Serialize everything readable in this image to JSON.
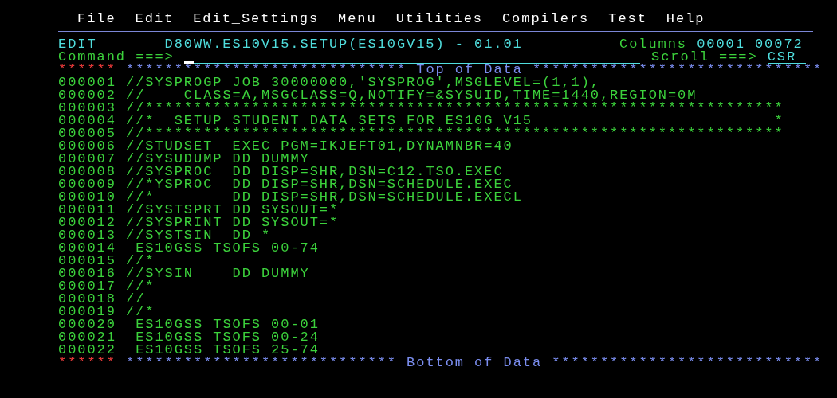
{
  "menu_bar": [
    {
      "key": "F",
      "tail": "ile"
    },
    {
      "key": "E",
      "tail": "dit"
    },
    {
      "lead": "E",
      "key": "d",
      "tail": "it_Settings"
    },
    {
      "key": "M",
      "tail": "enu"
    },
    {
      "key": "U",
      "tail": "tilities"
    },
    {
      "key": "C",
      "tail": "ompilers"
    },
    {
      "key": "T",
      "tail": "est"
    },
    {
      "key": "H",
      "tail": "elp"
    }
  ],
  "header": {
    "mode": "EDIT",
    "dataset": "D80WW.ES10V15.SETUP(ES10GV15) - 01.01",
    "columns_label": "Columns",
    "columns_from": "00001",
    "columns_to": "00072"
  },
  "command": {
    "label": "Command ===>",
    "cursor": true
  },
  "scroll": {
    "label": "Scroll ===>",
    "value": "CSR"
  },
  "lines": [
    {
      "kind": "marker",
      "number": "******",
      "text": "***************************** Top of Data ******************************"
    },
    {
      "kind": "data",
      "number": "000001",
      "text": "//SYSPROGP JOB 30000000,'SYSPROG',MSGLEVEL=(1,1),"
    },
    {
      "kind": "data",
      "number": "000002",
      "text": "//    CLASS=A,MSGCLASS=Q,NOTIFY=&SYSUID,TIME=1440,REGION=0M"
    },
    {
      "kind": "data",
      "number": "000003",
      "text": "//******************************************************************"
    },
    {
      "kind": "data",
      "number": "000004",
      "text": "//*  SETUP STUDENT DATA SETS FOR ES10G V15                         *"
    },
    {
      "kind": "data",
      "number": "000005",
      "text": "//******************************************************************"
    },
    {
      "kind": "data",
      "number": "000006",
      "text": "//STUDSET  EXEC PGM=IKJEFT01,DYNAMNBR=40"
    },
    {
      "kind": "data",
      "number": "000007",
      "text": "//SYSUDUMP DD DUMMY"
    },
    {
      "kind": "data",
      "number": "000008",
      "text": "//SYSPROC  DD DISP=SHR,DSN=C12.TSO.EXEC"
    },
    {
      "kind": "data",
      "number": "000009",
      "text": "//*YSPROC  DD DISP=SHR,DSN=SCHEDULE.EXEC"
    },
    {
      "kind": "data",
      "number": "000010",
      "text": "//*        DD DISP=SHR,DSN=SCHEDULE.EXECL"
    },
    {
      "kind": "data",
      "number": "000011",
      "text": "//SYSTSPRT DD SYSOUT=*"
    },
    {
      "kind": "data",
      "number": "000012",
      "text": "//SYSPRINT DD SYSOUT=*"
    },
    {
      "kind": "data",
      "number": "000013",
      "text": "//SYSTSIN  DD *"
    },
    {
      "kind": "data",
      "number": "000014",
      "text": " ES10GSS TSOFS 00-74"
    },
    {
      "kind": "data",
      "number": "000015",
      "text": "//*"
    },
    {
      "kind": "data",
      "number": "000016",
      "text": "//SYSIN    DD DUMMY"
    },
    {
      "kind": "data",
      "number": "000017",
      "text": "//*"
    },
    {
      "kind": "data",
      "number": "000018",
      "text": "//"
    },
    {
      "kind": "data",
      "number": "000019",
      "text": "//*"
    },
    {
      "kind": "data",
      "number": "000020",
      "text": " ES10GSS TSOFS 00-01"
    },
    {
      "kind": "data",
      "number": "000021",
      "text": " ES10GSS TSOFS 00-24"
    },
    {
      "kind": "data",
      "number": "000022",
      "text": " ES10GSS TSOFS 25-74"
    },
    {
      "kind": "marker",
      "number": "******",
      "text": "**************************** Bottom of Data ****************************"
    }
  ]
}
